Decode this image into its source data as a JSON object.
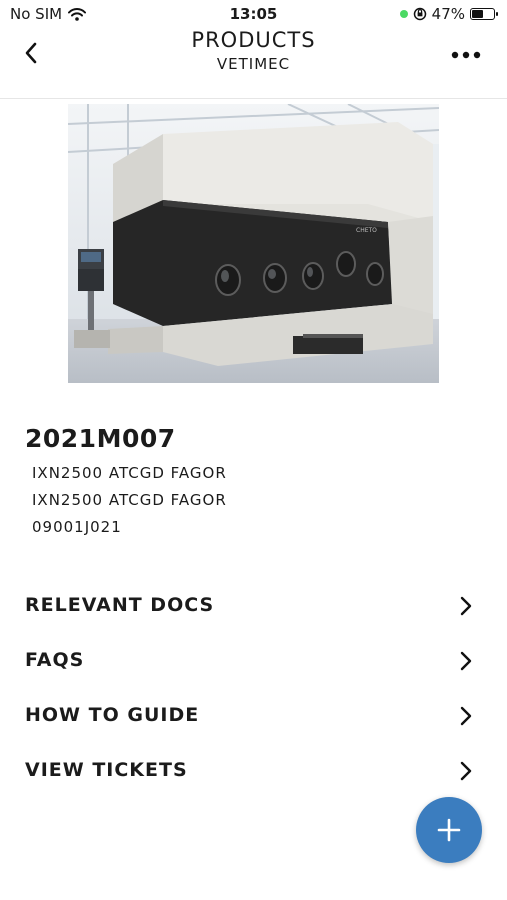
{
  "status_bar": {
    "carrier": "No SIM",
    "time": "13:05",
    "battery_percent": "47%",
    "battery_level": 0.47
  },
  "nav": {
    "title": "PRODUCTS",
    "subtitle": "VETIMEC"
  },
  "product": {
    "code": "2021M007",
    "details": [
      "IXN2500 ATCGD FAGOR",
      "IXN2500 ATCGD FAGOR",
      "09001J021"
    ],
    "machine_badge": "CHETO"
  },
  "menu": [
    {
      "label": "RELEVANT DOCS"
    },
    {
      "label": "FAQS"
    },
    {
      "label": "HOW TO GUIDE"
    },
    {
      "label": "VIEW TICKETS"
    }
  ],
  "fab_icon": "plus-icon",
  "colors": {
    "accent": "#3b7dbf",
    "machine_dark": "#262626",
    "machine_light": "#e4e3de"
  }
}
